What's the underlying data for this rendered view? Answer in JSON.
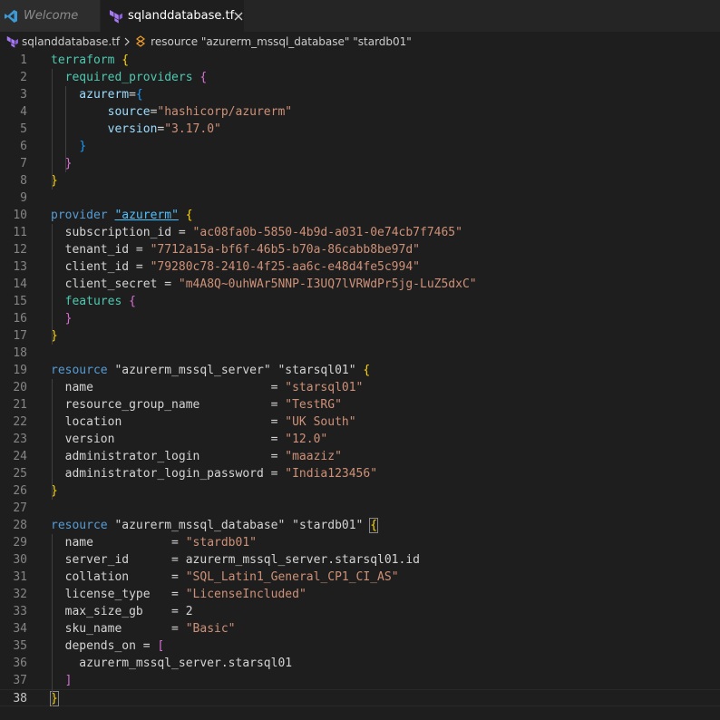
{
  "tabs": [
    {
      "label": "Welcome",
      "icon": "vscode-icon",
      "active": false
    },
    {
      "label": "sqlanddatabase.tf",
      "icon": "terraform-icon",
      "active": true
    }
  ],
  "breadcrumb": {
    "file": "sqlanddatabase.tf",
    "symbol": "resource \"azurerm_mssql_database\" \"stardb01\""
  },
  "editor": {
    "current_line": 38,
    "colors": {
      "keyword": "#569cd6",
      "type": "#4ec9b0",
      "string": "#ce9178",
      "property": "#9cdcfe",
      "bracket_1": "#ffd700",
      "bracket_2": "#da70d6",
      "bracket_3": "#179fff"
    },
    "lines": [
      {
        "n": "1",
        "t": [
          [
            "terraform ",
            "t"
          ],
          [
            "{",
            "b1"
          ]
        ]
      },
      {
        "n": "2",
        "t": [
          [
            "  required_providers ",
            "t"
          ],
          [
            "{",
            "b2"
          ]
        ]
      },
      {
        "n": "3",
        "t": [
          [
            "    azurerm",
            "p"
          ],
          [
            "=",
            ""
          ],
          [
            "{",
            "b3"
          ]
        ]
      },
      {
        "n": "4",
        "t": [
          [
            "        source",
            "p"
          ],
          [
            "=",
            ""
          ],
          [
            "\"hashicorp/azurerm\"",
            "s"
          ]
        ]
      },
      {
        "n": "5",
        "t": [
          [
            "        version",
            "p"
          ],
          [
            "=",
            ""
          ],
          [
            "\"3.17.0\"",
            "s"
          ]
        ]
      },
      {
        "n": "6",
        "t": [
          [
            "    ",
            ""
          ],
          [
            "}",
            "b3"
          ]
        ]
      },
      {
        "n": "7",
        "t": [
          [
            "  ",
            ""
          ],
          [
            "}",
            "b2"
          ]
        ]
      },
      {
        "n": "8",
        "t": [
          [
            "}",
            "b1"
          ]
        ]
      },
      {
        "n": "9",
        "t": []
      },
      {
        "n": "10",
        "t": [
          [
            "provider ",
            "k"
          ],
          [
            "\"azurerm\"",
            "lbl"
          ],
          [
            " ",
            ""
          ],
          [
            "{",
            "b1"
          ]
        ]
      },
      {
        "n": "11",
        "t": [
          [
            "  subscription_id = ",
            ""
          ],
          [
            "\"ac08fa0b-5850-4b9d-a031-0e74cb7f7465\"",
            "s"
          ]
        ]
      },
      {
        "n": "12",
        "t": [
          [
            "  tenant_id = ",
            ""
          ],
          [
            "\"7712a15a-bf6f-46b5-b70a-86cabb8be97d\"",
            "s"
          ]
        ]
      },
      {
        "n": "13",
        "t": [
          [
            "  client_id = ",
            ""
          ],
          [
            "\"79280c78-2410-4f25-aa6c-e48d4fe5c994\"",
            "s"
          ]
        ]
      },
      {
        "n": "14",
        "t": [
          [
            "  client_secret = ",
            ""
          ],
          [
            "\"m4A8Q~0uhWAr5NNP-I3UQ7lVRWdPr5jg-LuZ5dxC\"",
            "s"
          ]
        ]
      },
      {
        "n": "15",
        "t": [
          [
            "  features ",
            "t"
          ],
          [
            "{",
            "b2"
          ]
        ]
      },
      {
        "n": "16",
        "t": [
          [
            "  ",
            ""
          ],
          [
            "}",
            "b2"
          ]
        ]
      },
      {
        "n": "17",
        "t": [
          [
            "}",
            "b1"
          ]
        ]
      },
      {
        "n": "18",
        "t": []
      },
      {
        "n": "19",
        "t": [
          [
            "resource ",
            "k"
          ],
          [
            "\"azurerm_mssql_server\" \"starsql01\" ",
            ""
          ],
          [
            "{",
            "b1"
          ]
        ]
      },
      {
        "n": "20",
        "t": [
          [
            "  name                         = ",
            ""
          ],
          [
            "\"starsql01\"",
            "s"
          ]
        ]
      },
      {
        "n": "21",
        "t": [
          [
            "  resource_group_name          = ",
            ""
          ],
          [
            "\"TestRG\"",
            "s"
          ]
        ]
      },
      {
        "n": "22",
        "t": [
          [
            "  location                     = ",
            ""
          ],
          [
            "\"UK South\"",
            "s"
          ]
        ]
      },
      {
        "n": "23",
        "t": [
          [
            "  version                      = ",
            ""
          ],
          [
            "\"12.0\"",
            "s"
          ]
        ]
      },
      {
        "n": "24",
        "t": [
          [
            "  administrator_login          = ",
            ""
          ],
          [
            "\"maaziz\"",
            "s"
          ]
        ]
      },
      {
        "n": "25",
        "t": [
          [
            "  administrator_login_password = ",
            ""
          ],
          [
            "\"India123456\"",
            "s"
          ]
        ]
      },
      {
        "n": "26",
        "t": [
          [
            "}",
            "b1"
          ]
        ]
      },
      {
        "n": "27",
        "t": []
      },
      {
        "n": "28",
        "t": [
          [
            "resource ",
            "k"
          ],
          [
            "\"azurerm_mssql_database\" \"stardb01\" ",
            ""
          ],
          [
            "{",
            "b1 bmatch"
          ]
        ]
      },
      {
        "n": "29",
        "t": [
          [
            "  name           = ",
            ""
          ],
          [
            "\"stardb01\"",
            "s"
          ]
        ]
      },
      {
        "n": "30",
        "t": [
          [
            "  server_id      = azurerm_mssql_server.starsql01.id",
            ""
          ]
        ]
      },
      {
        "n": "31",
        "t": [
          [
            "  collation      = ",
            ""
          ],
          [
            "\"SQL_Latin1_General_CP1_CI_AS\"",
            "s"
          ]
        ]
      },
      {
        "n": "32",
        "t": [
          [
            "  license_type   = ",
            ""
          ],
          [
            "\"LicenseIncluded\"",
            "s"
          ]
        ]
      },
      {
        "n": "33",
        "t": [
          [
            "  max_size_gb    = 2",
            ""
          ]
        ]
      },
      {
        "n": "34",
        "t": [
          [
            "  sku_name       = ",
            ""
          ],
          [
            "\"Basic\"",
            "s"
          ]
        ]
      },
      {
        "n": "35",
        "t": [
          [
            "  depends_on = ",
            ""
          ],
          [
            "[",
            "b2"
          ]
        ]
      },
      {
        "n": "36",
        "t": [
          [
            "    azurerm_mssql_server.starsql01",
            ""
          ]
        ]
      },
      {
        "n": "37",
        "t": [
          [
            "  ",
            ""
          ],
          [
            "]",
            "b2"
          ]
        ]
      },
      {
        "n": "38",
        "t": [
          [
            "}",
            "b1 bmatch"
          ]
        ]
      }
    ]
  }
}
